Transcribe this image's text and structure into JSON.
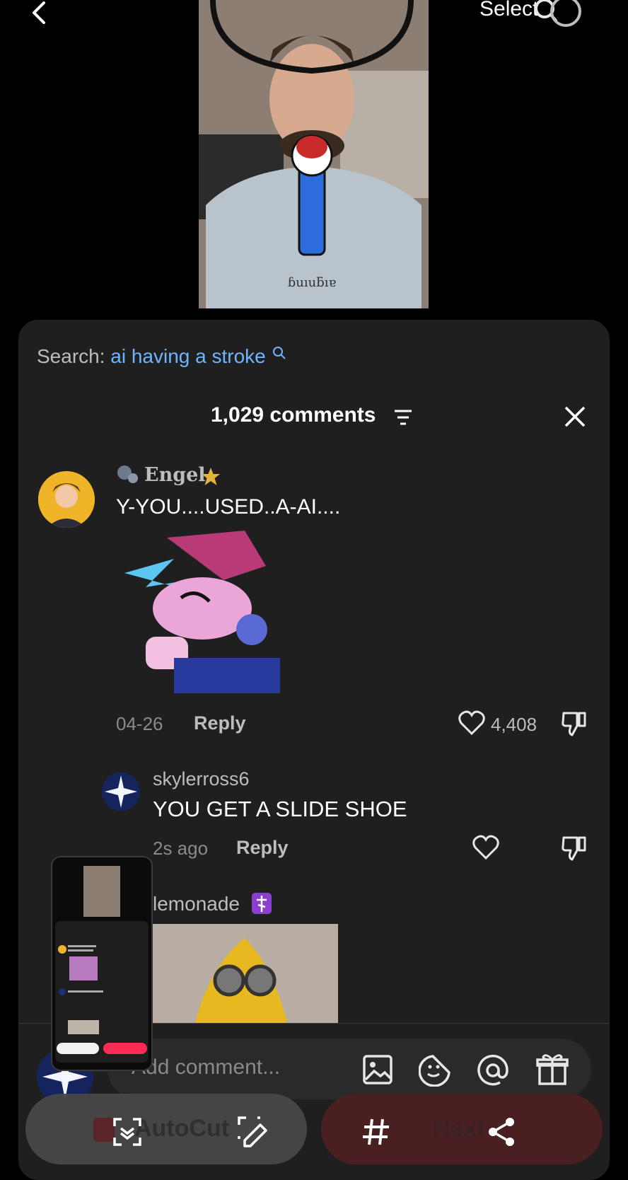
{
  "top_bar": {
    "select_label": "Select"
  },
  "search": {
    "prefix": "Search:",
    "query": "ai having a stroke"
  },
  "comments": {
    "count_label": "1,029 comments",
    "items": [
      {
        "username": "Engel",
        "text": "Y-YOU....USED..A-AI....",
        "date": "04-26",
        "reply_label": "Reply",
        "likes": "4,408"
      },
      {
        "username": "skylerross6",
        "text": "YOU GET A SLIDE SHOE",
        "date": "2s ago",
        "reply_label": "Reply",
        "likes": ""
      },
      {
        "username": "lemonade"
      }
    ]
  },
  "input": {
    "placeholder": "Add comment..."
  },
  "bottom_buttons": {
    "autocut_label": "AutoCut",
    "next_label": "Next"
  },
  "colors": {
    "panel_bg": "#1f1f1f",
    "search_query": "#6fb4ff",
    "accent_red": "#fe2c55"
  },
  "icons": [
    "back-arrow-icon",
    "search-icon",
    "filter-icon",
    "close-icon",
    "badge-icon",
    "star-icon",
    "heart-icon",
    "dislike-icon",
    "image-icon",
    "sticker-icon",
    "mention-icon",
    "gift-icon",
    "scan-icon",
    "edit-icon",
    "hashtag-icon",
    "share-icon"
  ]
}
